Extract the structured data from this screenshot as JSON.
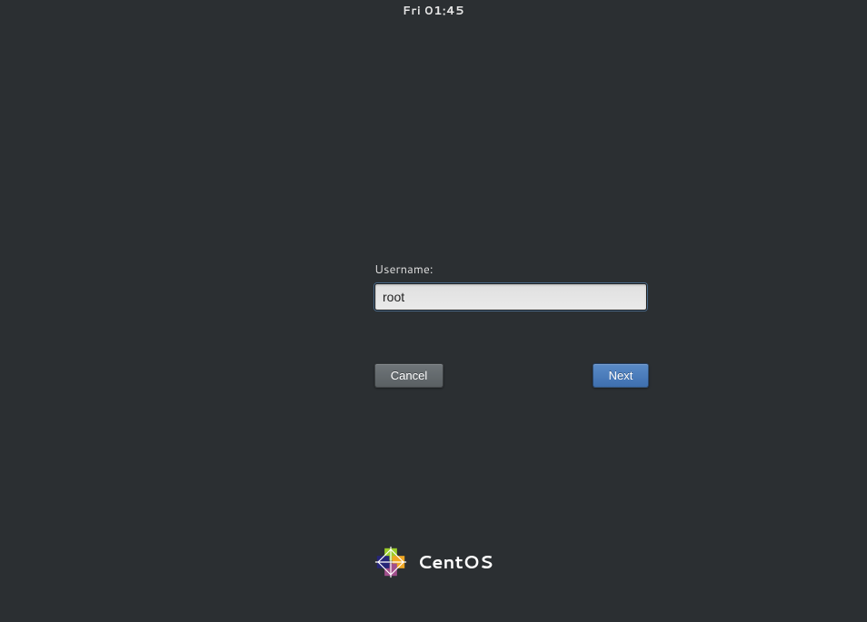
{
  "topbar": {
    "clock": "Fri 01:45"
  },
  "login": {
    "username_label": "Username:",
    "username_value": "root",
    "cancel_label": "Cancel",
    "next_label": "Next"
  },
  "branding": {
    "name": "CentOS"
  }
}
